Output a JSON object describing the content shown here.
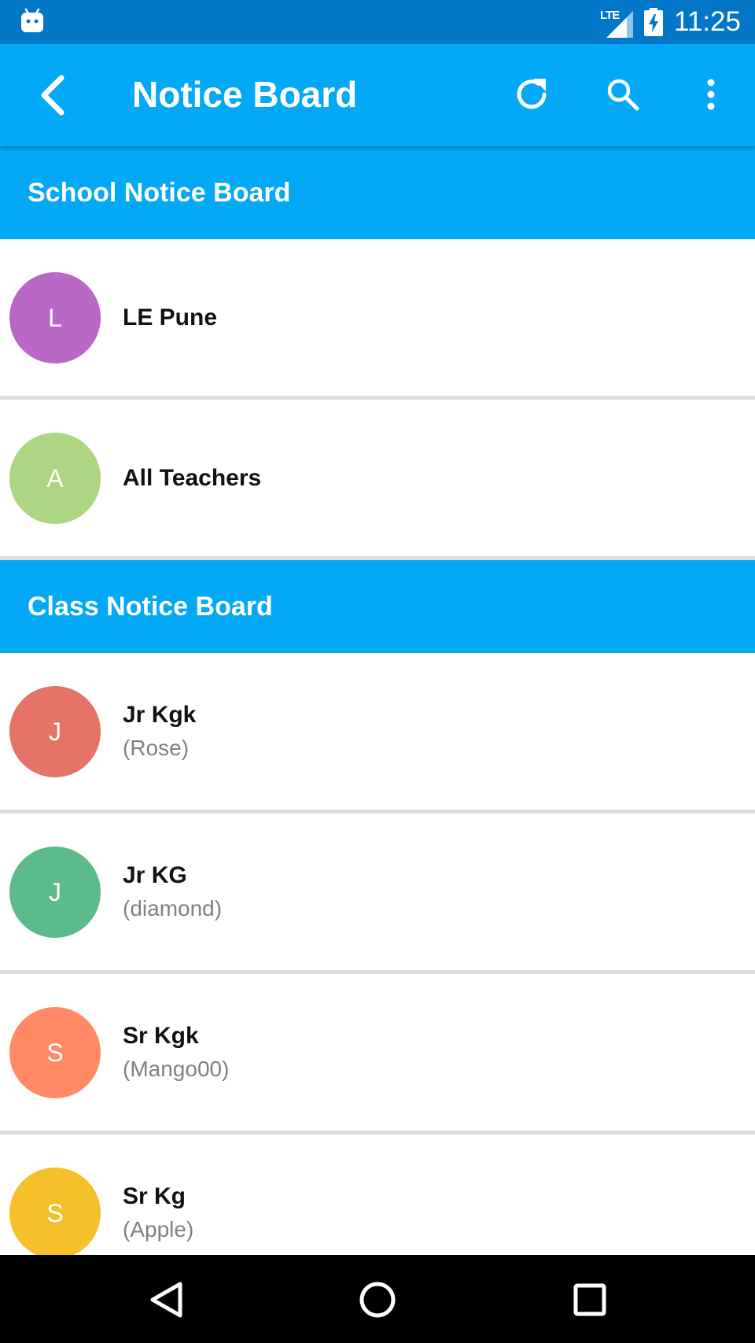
{
  "status_bar": {
    "network": "LTE",
    "time": "11:25"
  },
  "app_bar": {
    "title": "Notice Board"
  },
  "sections": [
    {
      "title": "School Notice Board",
      "items": [
        {
          "initial": "L",
          "name": "LE Pune",
          "sub": "",
          "color": "#ba68c8"
        },
        {
          "initial": "A",
          "name": "All Teachers",
          "sub": "",
          "color": "#aed581"
        }
      ]
    },
    {
      "title": "Class Notice Board",
      "items": [
        {
          "initial": "J",
          "name": "Jr Kgk",
          "sub": "(Rose)",
          "color": "#e57368"
        },
        {
          "initial": "J",
          "name": "Jr KG",
          "sub": "(diamond)",
          "color": "#5cbb8a"
        },
        {
          "initial": "S",
          "name": "Sr Kgk",
          "sub": "(Mango00)",
          "color": "#ff8a65"
        },
        {
          "initial": "S",
          "name": "Sr Kg",
          "sub": "(Apple)",
          "color": "#f6c02b"
        }
      ]
    }
  ],
  "colors": {
    "status_bar": "#0277c8",
    "primary": "#03a9f4"
  },
  "icons": {
    "back": "back-arrow-icon",
    "refresh": "refresh-icon",
    "search": "search-icon",
    "menu": "more-vert-icon"
  }
}
